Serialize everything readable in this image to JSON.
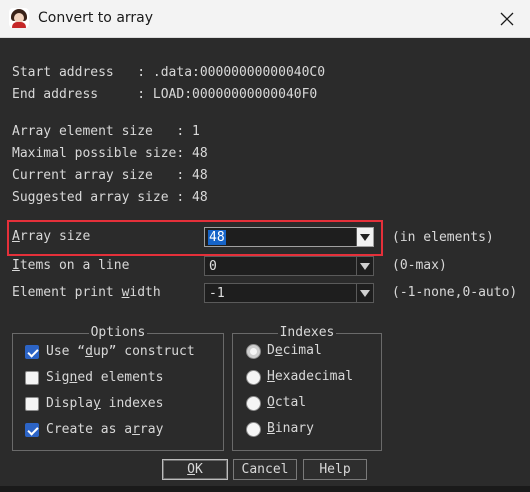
{
  "window": {
    "title": "Convert to array",
    "app_icon": "user-avatar-icon",
    "close_icon": "close-icon"
  },
  "info": {
    "start_label": "Start address   :",
    "start_value": ".data:00000000000040C0",
    "end_label": "End address     :",
    "end_value": "LOAD:00000000000040F0",
    "element_size_label": "Array element size   :",
    "element_size_value": "1",
    "max_size_label": "Maximal possible size:",
    "max_size_value": "48",
    "current_size_label": "Current array size   :",
    "current_size_value": "48",
    "suggested_size_label": "Suggested array size :",
    "suggested_size_value": "48"
  },
  "fields": [
    {
      "label_ul": "A",
      "label_rest": "rray size",
      "value": "48",
      "hint": "(in elements)"
    },
    {
      "label_ul": "I",
      "label_rest": "tems on a line",
      "value": "0",
      "hint": "(0-max)"
    },
    {
      "label_pre": "Element print ",
      "label_ul": "w",
      "label_rest": "idth",
      "value": "-1",
      "hint": "(-1-none,0-auto)"
    }
  ],
  "options": {
    "title": "Options",
    "items": [
      {
        "label_pre": "Use “",
        "label_ul": "d",
        "label_rest": "up” construct",
        "checked": true
      },
      {
        "label_pre": "Sig",
        "label_ul": "n",
        "label_rest": "ed elements",
        "checked": false
      },
      {
        "label_pre": "Displa",
        "label_ul": "y",
        "label_rest": " indexes",
        "checked": false
      },
      {
        "label_pre": "Create as a",
        "label_ul": "r",
        "label_rest": "ray",
        "checked": true
      }
    ]
  },
  "indexes": {
    "title": "Indexes",
    "items": [
      {
        "label_pre": "D",
        "label_ul": "e",
        "label_rest": "cimal",
        "selected": true
      },
      {
        "label_pre": "",
        "label_ul": "H",
        "label_rest": "exadecimal",
        "selected": false
      },
      {
        "label_pre": "",
        "label_ul": "O",
        "label_rest": "ctal",
        "selected": false
      },
      {
        "label_pre": "",
        "label_ul": "B",
        "label_rest": "inary",
        "selected": false
      }
    ]
  },
  "buttons": {
    "ok_ul": "O",
    "ok_rest": "K",
    "cancel": "Cancel",
    "help": "Help"
  },
  "colors": {
    "background": "#2b2b2b",
    "selection": "#1664c8",
    "highlight_box": "#e5303a",
    "checkbox_on": "#2c64c6"
  }
}
